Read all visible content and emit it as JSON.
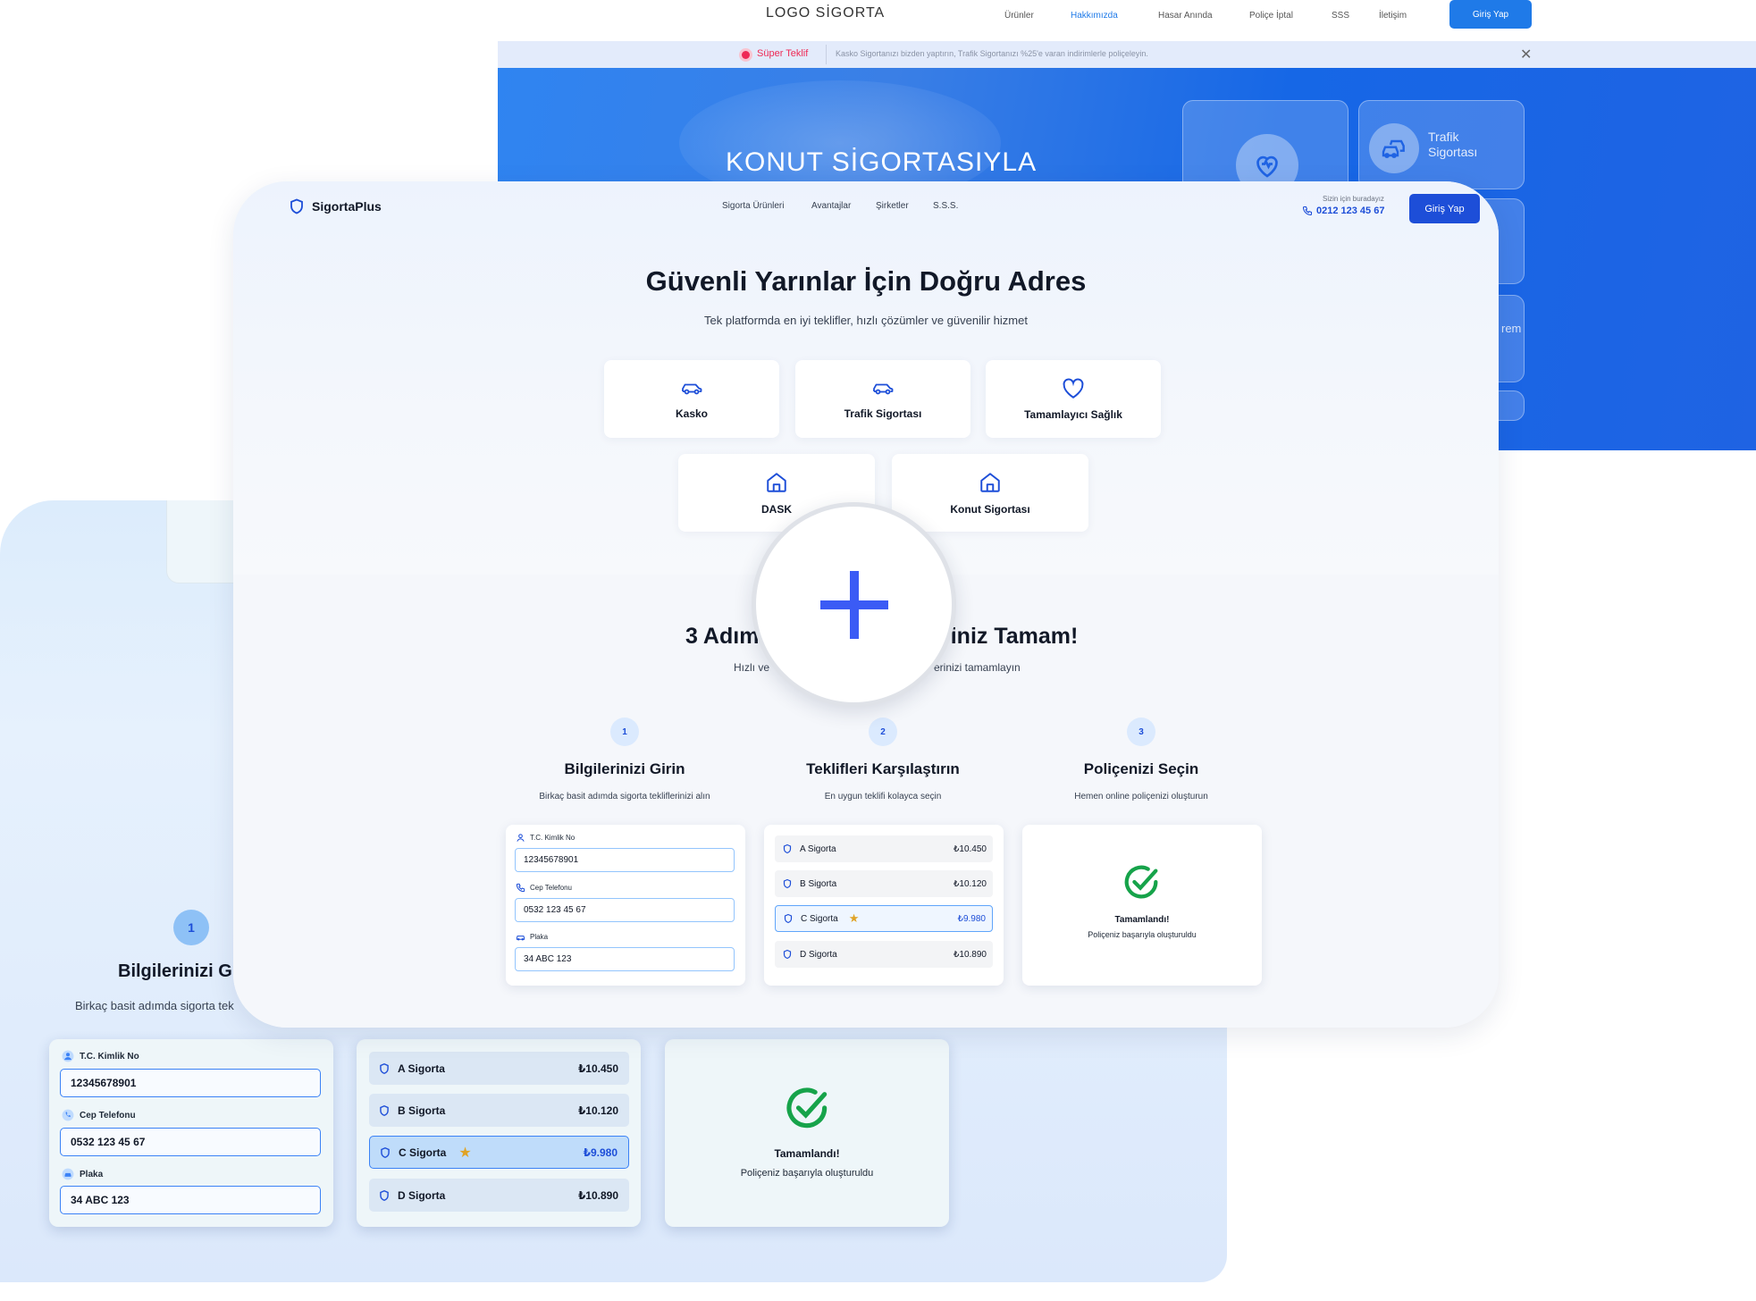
{
  "back_site": {
    "logo": "LOGO SİGORTA",
    "nav": [
      "Ürünler",
      "Hakkımızda",
      "Hasar Anında",
      "Poliçe İptal",
      "SSS",
      "İletişim"
    ],
    "login": "Giriş Yap",
    "banner_label": "Süper Teklif",
    "banner_text": "Kasko Sigortanızı bizden yaptırın, Trafik Sigortanızı %25'e varan indirimlerle poliçeleyin.",
    "hero_title": "KONUT SİGORTASIYLA",
    "card_trafik": "Trafik Sigortası",
    "card_partial": "rem",
    "accent": "#1f7ae8"
  },
  "front": {
    "brand": "SigortaPlus",
    "nav": [
      "Sigorta Ürünleri",
      "Avantajlar",
      "Şirketler",
      "S.S.S."
    ],
    "help_text": "Sizin için buradayız",
    "phone": "0212 123 45 67",
    "login": "Giriş Yap",
    "hero_title": "Güvenli Yarınlar İçin Doğru Adres",
    "hero_subtitle": "Tek platformda en iyi teklifler, hızlı çözümler ve güvenilir hizmet",
    "products": [
      {
        "label": "Kasko",
        "icon": "car-icon"
      },
      {
        "label": "Trafik Sigortası",
        "icon": "car-icon"
      },
      {
        "label": "Tamamlayıcı Sağlık",
        "icon": "heart-icon"
      },
      {
        "label": "DASK",
        "icon": "home-icon"
      },
      {
        "label": "Konut Sigortası",
        "icon": "home-icon"
      }
    ],
    "steps_title_left": "3 Adım",
    "steps_title_right": "riniz Tamam!",
    "steps_sub_left": "Hızlı ve",
    "steps_sub_right": "erinizi tamamlayın",
    "steps": [
      {
        "num": "1",
        "title": "Bilgilerinizi Girin",
        "desc": "Birkaç basit adımda sigorta tekliflerinizi alın"
      },
      {
        "num": "2",
        "title": "Teklifleri Karşılaştırın",
        "desc": "En uygun teklifi kolayca seçin"
      },
      {
        "num": "3",
        "title": "Poliçenizi Seçin",
        "desc": "Hemen online poliçenizi oluşturun"
      }
    ],
    "accent": "#1d4ed8"
  },
  "form": {
    "tc_label": "T.C. Kimlik No",
    "tc_value": "12345678901",
    "phone_label": "Cep Telefonu",
    "phone_value": "0532 123 45 67",
    "plate_label": "Plaka",
    "plate_value": "34 ABC 123"
  },
  "quotes": [
    {
      "name": "A Sigorta",
      "price": "₺10.450",
      "selected": false
    },
    {
      "name": "B Sigorta",
      "price": "₺10.120",
      "selected": false
    },
    {
      "name": "C Sigorta",
      "price": "₺9.980",
      "selected": true
    },
    {
      "name": "D Sigorta",
      "price": "₺10.890",
      "selected": false
    }
  ],
  "done": {
    "title": "Tamamlandı!",
    "desc": "Poliçeniz başarıyla oluşturuldu"
  },
  "zoom_layer": {
    "step_num": "1",
    "step_title": "Bilgilerinizi G",
    "step_desc": "Birkaç basit adımda sigorta tek"
  },
  "magnifier_icon": "plus-icon"
}
